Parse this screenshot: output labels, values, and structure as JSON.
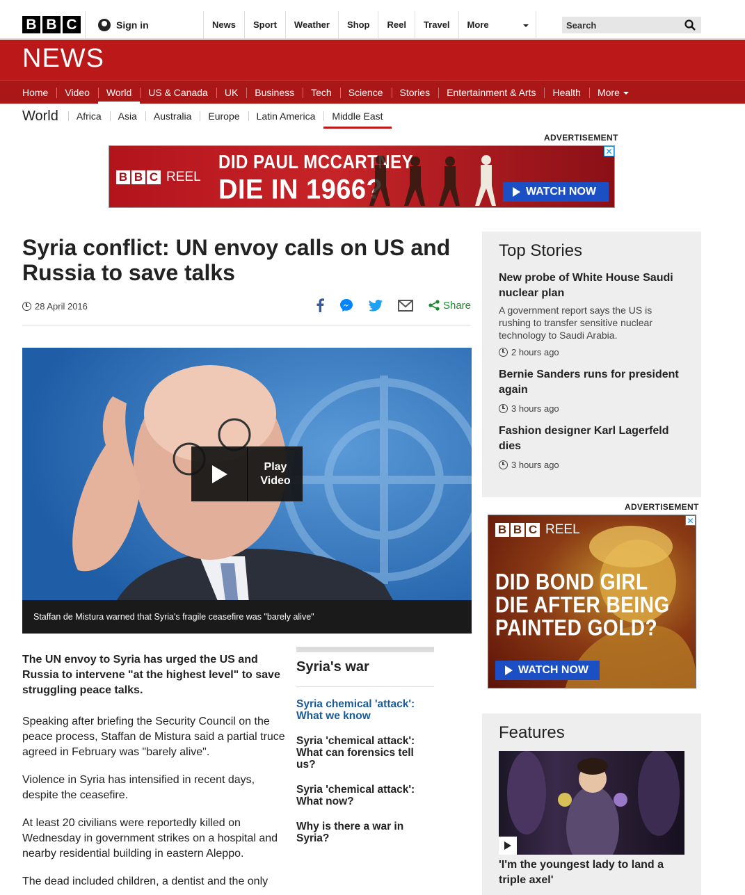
{
  "global_nav": {
    "logo_letters": [
      "B",
      "B",
      "C"
    ],
    "signin_label": "Sign in",
    "items": [
      "News",
      "Sport",
      "Weather",
      "Shop",
      "Reel",
      "Travel"
    ],
    "more_label": "More",
    "search_placeholder": "Search"
  },
  "news_banner": {
    "wordmark": "NEWS",
    "color": "#bb1919",
    "nav_items": [
      "Home",
      "Video",
      "World",
      "US & Canada",
      "UK",
      "Business",
      "Tech",
      "Science",
      "Stories",
      "Entertainment & Arts",
      "Health"
    ],
    "active_item": "World",
    "more_label": "More"
  },
  "section_nav": {
    "section": "World",
    "items": [
      "Africa",
      "Asia",
      "Australia",
      "Europe",
      "Latin America",
      "Middle East"
    ],
    "active_item": "Middle East"
  },
  "ad_top": {
    "label": "ADVERTISEMENT",
    "brand_letters": [
      "B",
      "B",
      "C"
    ],
    "brand_suffix": "REEL",
    "headline_line1": "DID PAUL McCARTNEY",
    "headline_line2": "DIE IN 1966?",
    "cta": "WATCH NOW"
  },
  "article": {
    "headline": "Syria conflict: UN envoy calls on US and Russia to save talks",
    "date": "28 April 2016",
    "share_label": "Share",
    "video_play_label_1": "Play",
    "video_play_label_2": "Video",
    "caption": "Staffan de Mistura warned that Syria's fragile ceasefire was \"barely alive\"",
    "intro": "The UN envoy to Syria has urged the US and Russia to intervene \"at the highest level\" to save struggling peace talks.",
    "paragraphs": [
      "Speaking after briefing the Security Council on the peace process, Staffan de Mistura said a partial truce agreed in February was \"barely alive\".",
      "Violence in Syria has intensified in recent days, despite the ceasefire.",
      "At least 20 civilians were reportedly killed on Wednesday in government strikes on a hospital and nearby residential building in eastern Aleppo.",
      "The dead included children, a dentist and the only"
    ]
  },
  "related": {
    "title": "Syria's war",
    "links": [
      "Syria chemical 'attack': What we know",
      "Syria 'chemical attack': What can forensics tell us?",
      "Syria 'chemical attack': What now?",
      "Why is there a war in Syria?"
    ]
  },
  "top_stories": {
    "title": "Top Stories",
    "items": [
      {
        "headline": "New probe of White House Saudi nuclear plan",
        "summary": "A government report says the US is rushing to transfer sensitive nuclear technology to Saudi Arabia.",
        "time": "2 hours ago"
      },
      {
        "headline": "Bernie Sanders runs for president again",
        "summary": "",
        "time": "3 hours ago"
      },
      {
        "headline": "Fashion designer Karl Lagerfeld dies",
        "summary": "",
        "time": "3 hours ago"
      }
    ]
  },
  "ad_side": {
    "label": "ADVERTISEMENT",
    "brand_letters": [
      "B",
      "B",
      "C"
    ],
    "brand_suffix": "REEL",
    "headline_line1": "DID BOND GIRL",
    "headline_line2": "DIE AFTER BEING",
    "headline_line3": "PAINTED GOLD?",
    "cta": "WATCH NOW"
  },
  "features": {
    "title": "Features",
    "item_title": "'I'm the youngest lady to land a triple axel'"
  }
}
